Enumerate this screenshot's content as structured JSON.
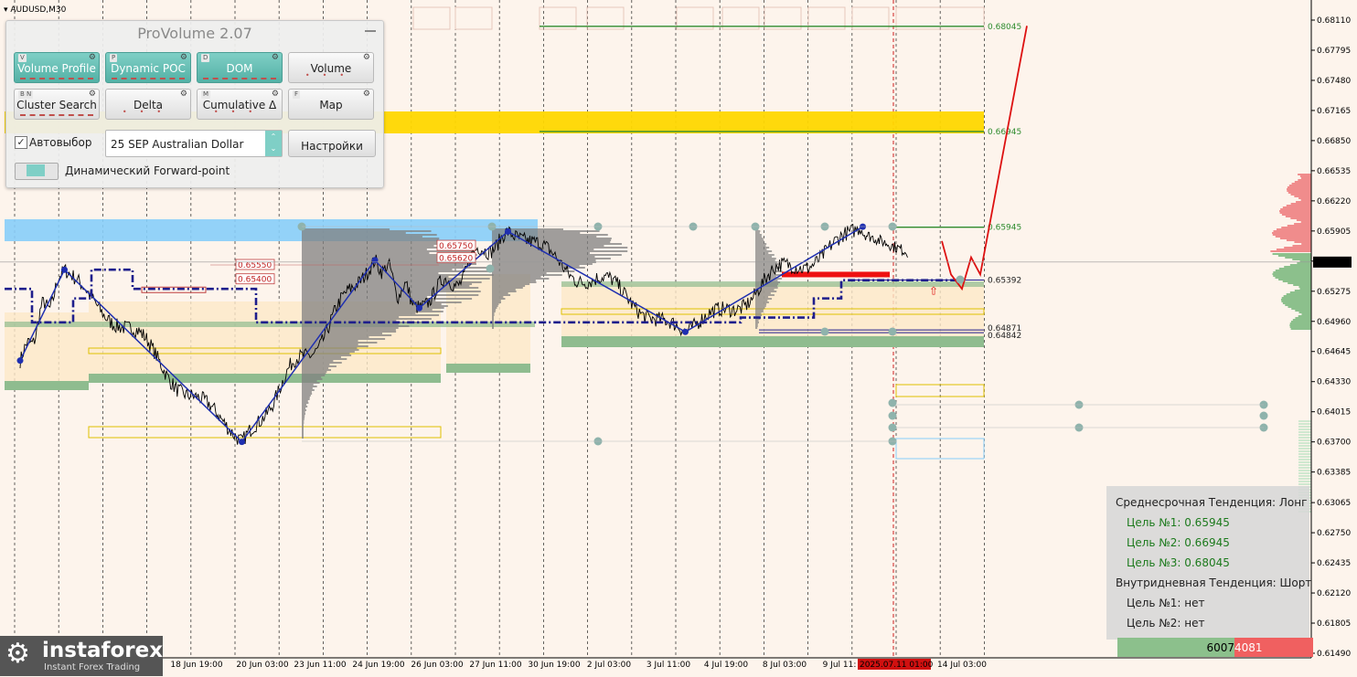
{
  "chart_header": {
    "symbol": "AUDUSD,M30"
  },
  "panel": {
    "title": "ProVolume 2.07",
    "buttons": [
      {
        "key": "V",
        "label": "Volume Profile",
        "active": true
      },
      {
        "key": "P",
        "label": "Dynamic POC",
        "active": true
      },
      {
        "key": "D",
        "label": "DOM",
        "active": true
      },
      {
        "key": "",
        "label": "Volume",
        "active": false
      },
      {
        "key": "B N",
        "label": "Cluster Search",
        "active": false
      },
      {
        "key": "",
        "label": "Delta",
        "active": false
      },
      {
        "key": "M",
        "label": "Cumulative Δ",
        "active": false
      },
      {
        "key": "F",
        "label": "Map",
        "active": false
      }
    ],
    "autoselect_label": "Автовыбор",
    "autoselect_checked": true,
    "instrument": "25 SEP Australian Dollar",
    "settings_label": "Настройки",
    "forward_point_label": "Динамический Forward-point"
  },
  "info_box": {
    "medium_trend": "Среднесрочная Тенденция: Лонг",
    "medium_targets": [
      "Цель №1: 0.65945",
      "Цель №2: 0.66945",
      "Цель №3: 0.68045"
    ],
    "intraday_trend": "Внутридневная Тенденция: Шорт",
    "intraday_targets": [
      "Цель №1: нет",
      "Цель №2: нет"
    ]
  },
  "counter": {
    "buy": "6007",
    "sell": "4081"
  },
  "logo": {
    "brand": "instaforex",
    "tagline": "Instant Forex Trading"
  },
  "colors": {
    "background": "#fdf4ec",
    "price": "#000000",
    "zigzag": "#1f2fb0",
    "poc_line": "#1e1e8c",
    "yellow_zone": "#ffd700",
    "blue_zone": "#87cefa",
    "green_band": "#8fbc8f",
    "target_line": "#2e8b2e",
    "forecast": "#dd1111",
    "volume_profile": "#808080"
  },
  "chart_data": {
    "type": "line",
    "title": "",
    "xlabel": "",
    "ylabel": "",
    "ylim": [
      0.6149,
      0.6821
    ],
    "y_ticks": [
      "0.68110",
      "0.67795",
      "0.67480",
      "0.67165",
      "0.66850",
      "0.66535",
      "0.66220",
      "0.65905",
      "0.65590",
      "0.65275",
      "0.64960",
      "0.64645",
      "0.64330",
      "0.64015",
      "0.63700",
      "0.63385",
      "0.63065",
      "0.62750",
      "0.62435",
      "0.62120",
      "0.61805",
      "0.61490"
    ],
    "current_price": "0.65580",
    "x_labels": [
      "18 Jun 19:00",
      "20 Jun 03:00",
      "23 Jun 11:00",
      "24 Jun 19:00",
      "26 Jun 03:00",
      "27 Jun 11:00",
      "30 Jun 19:00",
      "2 Jul 03:00",
      "3 Jul 11:00",
      "4 Jul 19:00",
      "8 Jul 03:00",
      "9 Jul 11:",
      "2025.07.11 01:00",
      "14 Jul 03:00"
    ],
    "price_levels": [
      {
        "label": "0.68045",
        "value": 0.68045,
        "kind": "target"
      },
      {
        "label": "0.66945",
        "value": 0.66945,
        "kind": "target"
      },
      {
        "label": "0.65945",
        "value": 0.65945,
        "kind": "target"
      },
      {
        "label": "0.65392",
        "value": 0.65392,
        "kind": "level"
      },
      {
        "label": "0.64871",
        "value": 0.64871,
        "kind": "level"
      },
      {
        "label": "0.64842",
        "value": 0.64842,
        "kind": "level"
      }
    ],
    "poc_labels": [
      {
        "label": "0.65750",
        "value": 0.6575
      },
      {
        "label": "0.65620",
        "value": 0.6562
      },
      {
        "label": "0.65550",
        "value": 0.6555
      },
      {
        "label": "0.65400",
        "value": 0.654
      }
    ],
    "zigzag": [
      {
        "t": "2025-06-16",
        "y": 0.6455
      },
      {
        "t": "2025-06-17",
        "y": 0.655
      },
      {
        "t": "2025-06-23",
        "y": 0.637
      },
      {
        "t": "2025-06-26",
        "y": 0.656
      },
      {
        "t": "2025-06-27",
        "y": 0.651
      },
      {
        "t": "2025-07-01",
        "y": 0.659
      },
      {
        "t": "2025-07-07",
        "y": 0.6485
      },
      {
        "t": "2025-07-11",
        "y": 0.6595
      }
    ],
    "forecast": [
      {
        "t": "2025-07-14",
        "y": 0.6558
      },
      {
        "t": "2025-07-14",
        "y": 0.6545
      },
      {
        "t": "2025-07-15",
        "y": 0.6595
      },
      {
        "t": "2025-07-16",
        "y": 0.6805
      }
    ]
  }
}
